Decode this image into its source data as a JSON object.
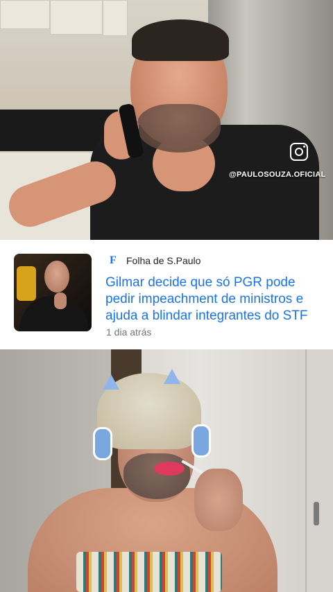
{
  "video_top": {
    "social_icon": "instagram-icon",
    "handle": "@PAULOSOUZA.OFICIAL"
  },
  "news_card": {
    "publisher_logo": "F",
    "publisher_name": "Folha de S.Paulo",
    "headline": "Gilmar decide que só PGR pode pedir impeachment de ministros e ajuda a blindar integrantes do STF",
    "time_ago": "1 dia atrás",
    "accent_color": "#1a73e8"
  },
  "video_bottom": {}
}
